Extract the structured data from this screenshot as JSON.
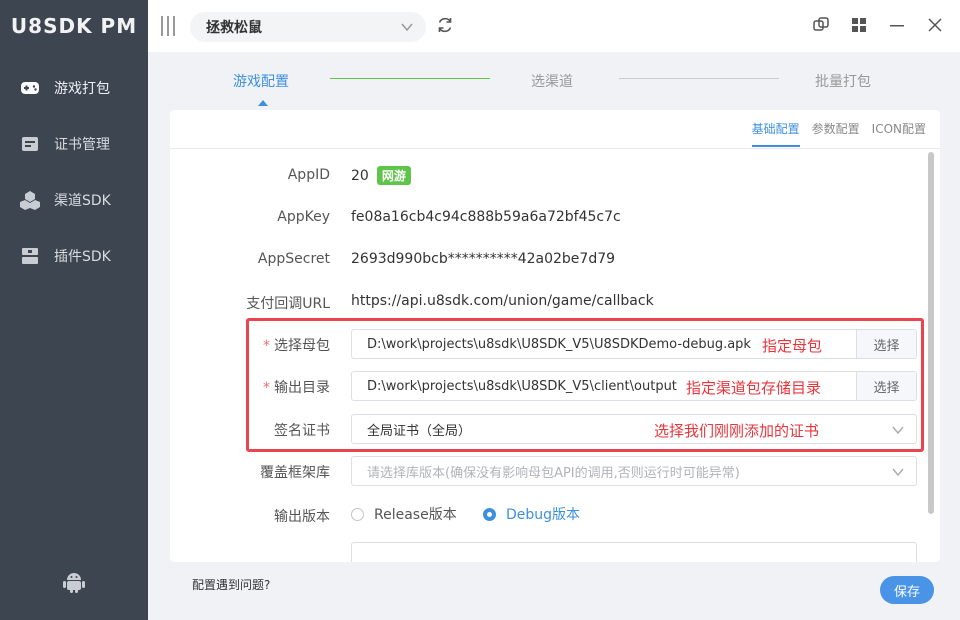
{
  "sidebar": {
    "brand": "U8SDK PM",
    "items": [
      {
        "label": "游戏打包",
        "icon": "gamepad-icon",
        "active": true
      },
      {
        "label": "证书管理",
        "icon": "certificate-icon"
      },
      {
        "label": "渠道SDK",
        "icon": "cubes-icon"
      },
      {
        "label": "插件SDK",
        "icon": "plugin-icon"
      }
    ],
    "bottom_icon": "android-icon"
  },
  "topbar": {
    "game_selected": "拯救松鼠"
  },
  "steps": [
    {
      "label": "游戏配置",
      "state": "active"
    },
    {
      "label": "选渠道",
      "state": "pending"
    },
    {
      "label": "批量打包",
      "state": "pending"
    }
  ],
  "subtabs": [
    "基础配置",
    "参数配置",
    "ICON配置"
  ],
  "form": {
    "appid": {
      "label": "AppID",
      "value": "20",
      "badge": "网游"
    },
    "appkey": {
      "label": "AppKey",
      "value": "fe08a16cb4c94c888b59a6a72bf45c7c"
    },
    "appsecret": {
      "label": "AppSecret",
      "value": "2693d990bcb**********42a02be7d79"
    },
    "callback": {
      "label": "支付回调URL",
      "value": "https://api.u8sdk.com/union/game/callback"
    },
    "base_apk": {
      "required": "*",
      "label": "选择母包",
      "value": "D:\\work\\projects\\u8sdk\\U8SDK_V5\\U8SDKDemo-debug.apk",
      "button": "选择",
      "annotation": "指定母包"
    },
    "output_dir": {
      "required": "*",
      "label": "输出目录",
      "value": "D:\\work\\projects\\u8sdk\\U8SDK_V5\\client\\output",
      "button": "选择",
      "annotation": "指定渠道包存储目录"
    },
    "sign_cert": {
      "label": "签名证书",
      "value": "全局证书（全局）",
      "annotation": "选择我们刚刚添加的证书"
    },
    "framework": {
      "label": "覆盖框架库",
      "placeholder": "请选择库版本(确保没有影响母包API的调用,否则运行时可能异常)"
    },
    "build_version": {
      "label": "输出版本",
      "options": [
        {
          "label": "Release版本",
          "checked": false
        },
        {
          "label": "Debug版本",
          "checked": true
        }
      ]
    }
  },
  "footer": {
    "help_link": "配置遇到问题?",
    "save_button": "保存"
  },
  "colors": {
    "accent": "#3d8fe0",
    "sidebar_bg": "#3d4550",
    "annotation": "#e8363c",
    "badge": "#5ec44a"
  }
}
